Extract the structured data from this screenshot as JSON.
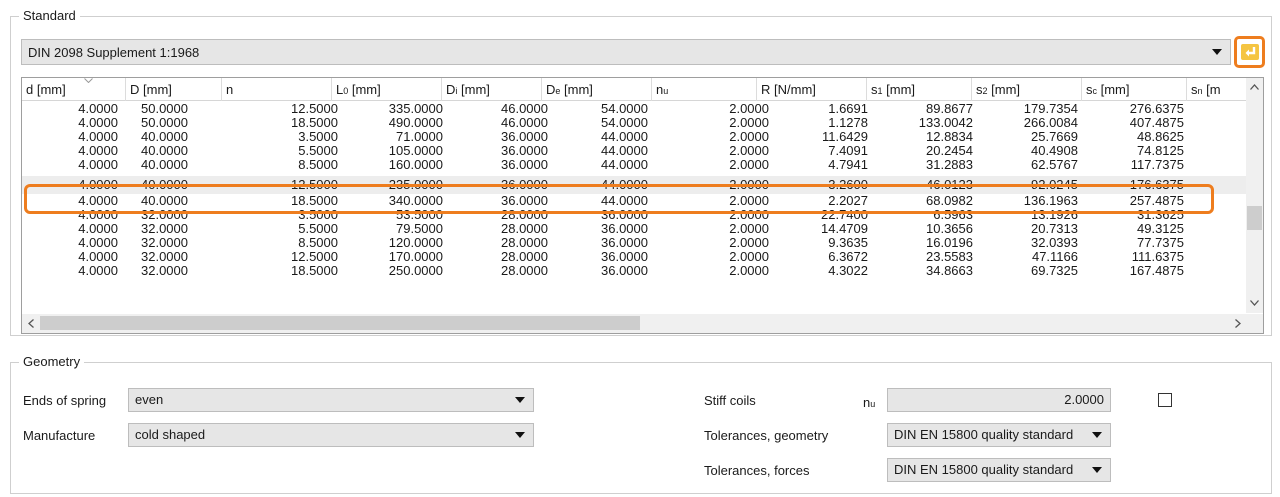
{
  "standard": {
    "title": "Standard",
    "selected": "DIN 2098 Supplement 1:1968"
  },
  "table": {
    "columns": [
      {
        "base": "d [mm]",
        "sub": ""
      },
      {
        "base": "D [mm]",
        "sub": ""
      },
      {
        "base": "n",
        "sub": ""
      },
      {
        "base": "L",
        "sub": "0",
        "unit": " [mm]"
      },
      {
        "base": "D",
        "sub": "i",
        "unit": " [mm]"
      },
      {
        "base": "D",
        "sub": "e",
        "unit": " [mm]"
      },
      {
        "base": "n",
        "sub": "u",
        "unit": ""
      },
      {
        "base": "R [N/mm]",
        "sub": ""
      },
      {
        "base": "s",
        "sub": "1",
        "unit": " [mm]"
      },
      {
        "base": "s",
        "sub": "2",
        "unit": " [mm]"
      },
      {
        "base": "s",
        "sub": "c",
        "unit": " [mm]"
      },
      {
        "base": "s",
        "sub": "n",
        "unit": " [m"
      }
    ],
    "rows": [
      [
        "4.0000",
        "50.0000",
        "12.5000",
        "335.0000",
        "46.0000",
        "54.0000",
        "2.0000",
        "1.6691",
        "89.8677",
        "179.7354",
        "276.6375"
      ],
      [
        "4.0000",
        "50.0000",
        "18.5000",
        "490.0000",
        "46.0000",
        "54.0000",
        "2.0000",
        "1.1278",
        "133.0042",
        "266.0084",
        "407.4875"
      ],
      [
        "4.0000",
        "40.0000",
        "3.5000",
        "71.0000",
        "36.0000",
        "44.0000",
        "2.0000",
        "11.6429",
        "12.8834",
        "25.7669",
        "48.8625"
      ],
      [
        "4.0000",
        "40.0000",
        "5.5000",
        "105.0000",
        "36.0000",
        "44.0000",
        "2.0000",
        "7.4091",
        "20.2454",
        "40.4908",
        "74.8125"
      ],
      [
        "4.0000",
        "40.0000",
        "8.5000",
        "160.0000",
        "36.0000",
        "44.0000",
        "2.0000",
        "4.7941",
        "31.2883",
        "62.5767",
        "117.7375"
      ],
      [
        "4.0000",
        "40.0000",
        "12.5000",
        "235.0000",
        "36.0000",
        "44.0000",
        "2.0000",
        "3.2600",
        "46.0123",
        "92.0245",
        "176.6375"
      ],
      [
        "4.0000",
        "40.0000",
        "18.5000",
        "340.0000",
        "36.0000",
        "44.0000",
        "2.0000",
        "2.2027",
        "68.0982",
        "136.1963",
        "257.4875"
      ],
      [
        "4.0000",
        "32.0000",
        "3.5000",
        "53.5000",
        "28.0000",
        "36.0000",
        "2.0000",
        "22.7400",
        "6.5963",
        "13.1926",
        "31.3625"
      ],
      [
        "4.0000",
        "32.0000",
        "5.5000",
        "79.5000",
        "28.0000",
        "36.0000",
        "2.0000",
        "14.4709",
        "10.3656",
        "20.7313",
        "49.3125"
      ],
      [
        "4.0000",
        "32.0000",
        "8.5000",
        "120.0000",
        "28.0000",
        "36.0000",
        "2.0000",
        "9.3635",
        "16.0196",
        "32.0393",
        "77.7375"
      ],
      [
        "4.0000",
        "32.0000",
        "12.5000",
        "170.0000",
        "28.0000",
        "36.0000",
        "2.0000",
        "6.3672",
        "23.5583",
        "47.1166",
        "111.6375"
      ],
      [
        "4.0000",
        "32.0000",
        "18.5000",
        "250.0000",
        "28.0000",
        "36.0000",
        "2.0000",
        "4.3022",
        "34.8663",
        "69.7325",
        "167.4875"
      ]
    ],
    "selected_row": 5
  },
  "geometry": {
    "title": "Geometry",
    "ends_label": "Ends of spring",
    "ends_value": "even",
    "manufacture_label": "Manufacture",
    "manufacture_value": "cold shaped",
    "stiff_coils_label": "Stiff coils",
    "stiff_coils_symbol": "n",
    "stiff_coils_symbol_sub": "u",
    "stiff_coils_value": "2.0000",
    "tol_geometry_label": "Tolerances, geometry",
    "tol_geometry_value": "DIN EN 15800 quality standard",
    "tol_forces_label": "Tolerances, forces",
    "tol_forces_value": "DIN EN 15800 quality standard"
  },
  "colors": {
    "highlight": "#ee7d1e",
    "field_bg": "#e6e6e6"
  },
  "icons": {
    "apply": "return-arrow-icon"
  }
}
